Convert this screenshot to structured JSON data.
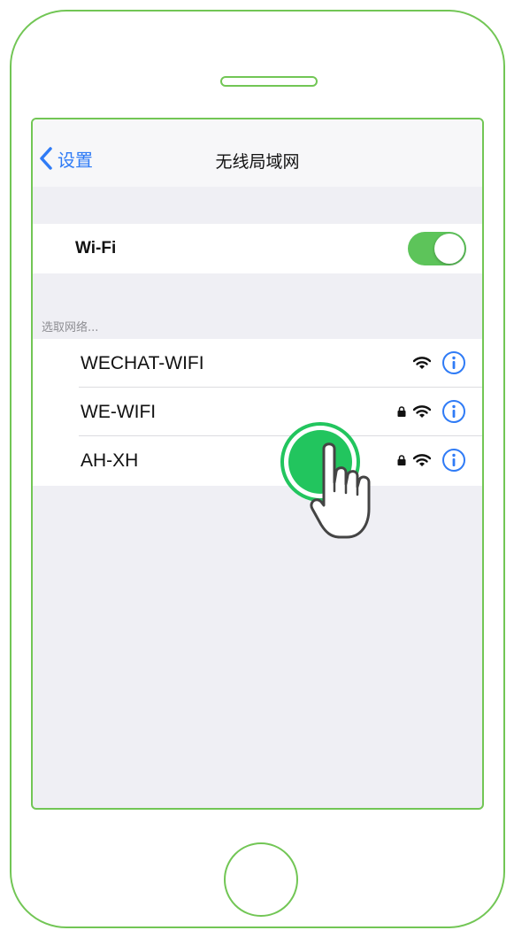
{
  "navbar": {
    "back_label": "设置",
    "title": "无线局域网"
  },
  "wifi_toggle": {
    "label": "Wi-Fi",
    "state": "on"
  },
  "networks": {
    "header": "选取网络...",
    "items": [
      {
        "name": "WECHAT-WIFI",
        "locked": false
      },
      {
        "name": "WE-WIFI",
        "locked": true
      },
      {
        "name": "AH-XH",
        "locked": true
      }
    ]
  },
  "colors": {
    "frame": "#72c655",
    "toggle_on": "#5dc45a",
    "ios_blue": "#2f7bf6",
    "tap_indicator": "#22c55e"
  },
  "icons": [
    "chevron-left-icon",
    "lock-icon",
    "wifi-signal-icon",
    "info-icon",
    "hand-pointer-icon"
  ]
}
